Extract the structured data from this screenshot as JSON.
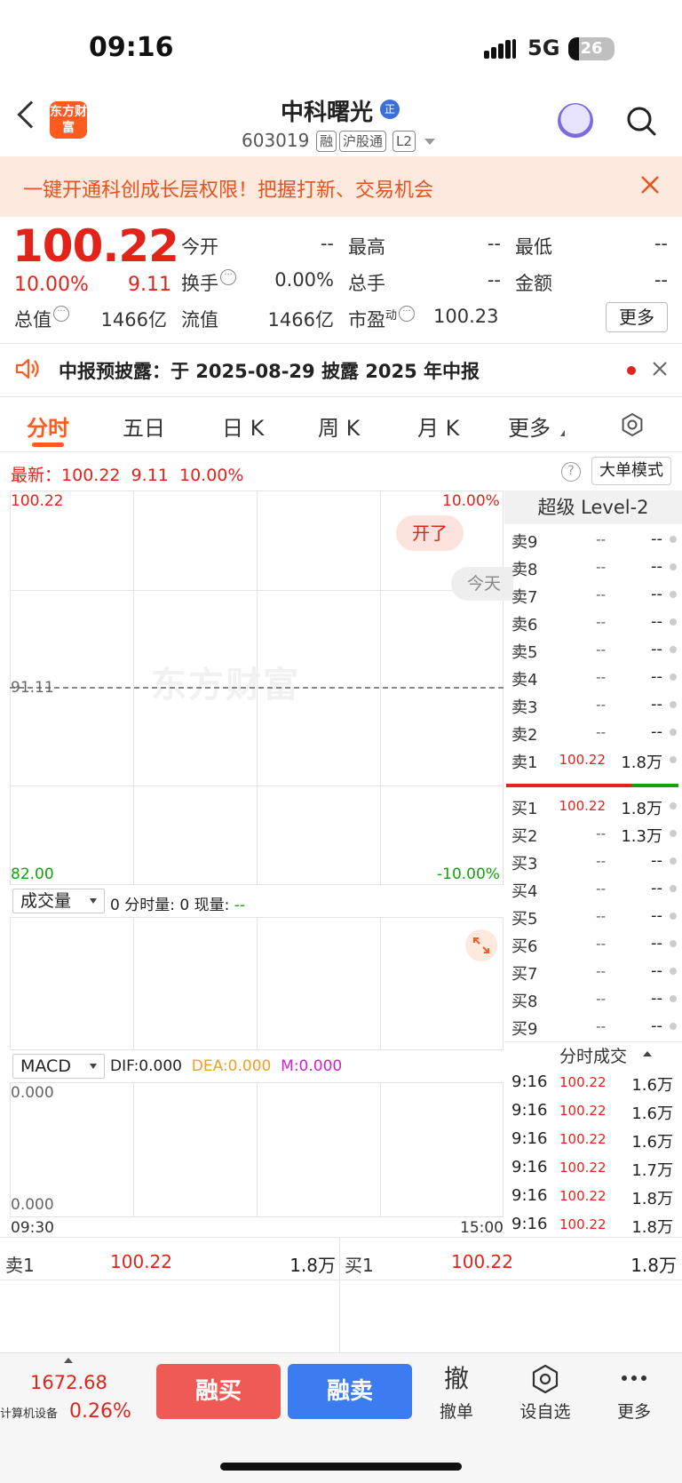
{
  "status_bar": {
    "time": "09:16",
    "network": "5G",
    "battery": "26"
  },
  "header": {
    "logo": "东方财富",
    "stock_name": "中科曙光",
    "name_badge": "正",
    "stock_code": "603019",
    "tags": [
      "融",
      "沪股通",
      "L2"
    ]
  },
  "banner": {
    "text": "一键开通科创成长层权限！把握打新、交易机会"
  },
  "quote": {
    "price": "100.22",
    "change_pct": "10.00%",
    "change": "9.11",
    "fields": [
      {
        "label": "今开",
        "value": "--"
      },
      {
        "label": "最高",
        "value": "--"
      },
      {
        "label": "最低",
        "value": "--"
      },
      {
        "label": "换手",
        "value": "0.00%"
      },
      {
        "label": "总手",
        "value": "--"
      },
      {
        "label": "金额",
        "value": "--"
      },
      {
        "label": "总值",
        "value": "1466亿"
      },
      {
        "label": "流值",
        "value": "1466亿"
      },
      {
        "label": "市盈",
        "sup": "动",
        "value": "100.23"
      }
    ],
    "more_label": "更多"
  },
  "notice": {
    "text": "中报预披露：于 2025-08-29 披露 2025 年中报"
  },
  "tabs": [
    "分时",
    "五日",
    "日 K",
    "周 K",
    "月 K",
    "更多"
  ],
  "chart_info": {
    "latest_label": "最新：",
    "latest_price": "100.22",
    "latest_change": "9.11",
    "latest_pct": "10.00%",
    "mode_button": "大单模式"
  },
  "chart": {
    "y_top": "100.22",
    "y_mid": "91.11",
    "y_bottom": "82.00",
    "pct_top": "10.00%",
    "pct_bottom": "-10.00%",
    "watermark": "东方财富",
    "badge_open": "开了",
    "badge_today": "今天",
    "time_start": "09:30",
    "time_end": "15:00"
  },
  "volume": {
    "select": "成交量",
    "info_prefix": "0 分时量: 0 现量: ",
    "info_value": "--"
  },
  "macd": {
    "select": "MACD",
    "dif": "DIF:0.000",
    "dea": "DEA:0.000",
    "m": "M:0.000",
    "y_top": "0.000",
    "y_bottom": "0.000"
  },
  "order_book": {
    "title": "超级 Level-2",
    "asks": [
      {
        "label": "卖9",
        "price": "--",
        "vol": "--"
      },
      {
        "label": "卖8",
        "price": "--",
        "vol": "--"
      },
      {
        "label": "卖7",
        "price": "--",
        "vol": "--"
      },
      {
        "label": "卖6",
        "price": "--",
        "vol": "--"
      },
      {
        "label": "卖5",
        "price": "--",
        "vol": "--"
      },
      {
        "label": "卖4",
        "price": "--",
        "vol": "--"
      },
      {
        "label": "卖3",
        "price": "--",
        "vol": "--"
      },
      {
        "label": "卖2",
        "price": "--",
        "vol": "--"
      },
      {
        "label": "卖1",
        "price": "100.22",
        "vol": "1.8万"
      }
    ],
    "bids": [
      {
        "label": "买1",
        "price": "100.22",
        "vol": "1.8万"
      },
      {
        "label": "买2",
        "price": "--",
        "vol": "1.3万"
      },
      {
        "label": "买3",
        "price": "--",
        "vol": "--"
      },
      {
        "label": "买4",
        "price": "--",
        "vol": "--"
      },
      {
        "label": "买5",
        "price": "--",
        "vol": "--"
      },
      {
        "label": "买6",
        "price": "--",
        "vol": "--"
      },
      {
        "label": "买7",
        "price": "--",
        "vol": "--"
      },
      {
        "label": "买8",
        "price": "--",
        "vol": "--"
      },
      {
        "label": "买9",
        "price": "--",
        "vol": "--"
      }
    ],
    "bid_ratio": 0.73
  },
  "trades": {
    "title": "分时成交",
    "rows": [
      {
        "time": "9:16",
        "price": "100.22",
        "vol": "1.6万"
      },
      {
        "time": "9:16",
        "price": "100.22",
        "vol": "1.6万"
      },
      {
        "time": "9:16",
        "price": "100.22",
        "vol": "1.6万"
      },
      {
        "time": "9:16",
        "price": "100.22",
        "vol": "1.7万"
      },
      {
        "time": "9:16",
        "price": "100.22",
        "vol": "1.8万"
      },
      {
        "time": "9:16",
        "price": "100.22",
        "vol": "1.8万"
      }
    ]
  },
  "quote_bar": {
    "sell_label": "卖1",
    "sell_price": "100.22",
    "sell_vol": "1.8万",
    "buy_label": "买1",
    "buy_price": "100.22",
    "buy_vol": "1.8万"
  },
  "bottom_bar": {
    "index_value": "1672.68",
    "index_name": "计算机设备",
    "index_pct": "0.26%",
    "buy_button": "融买",
    "sell_button": "融卖",
    "items": [
      {
        "icon": "撤",
        "label": "撤单"
      },
      {
        "icon": "settings",
        "label": "设自选"
      },
      {
        "icon": "more",
        "label": "更多"
      }
    ]
  }
}
